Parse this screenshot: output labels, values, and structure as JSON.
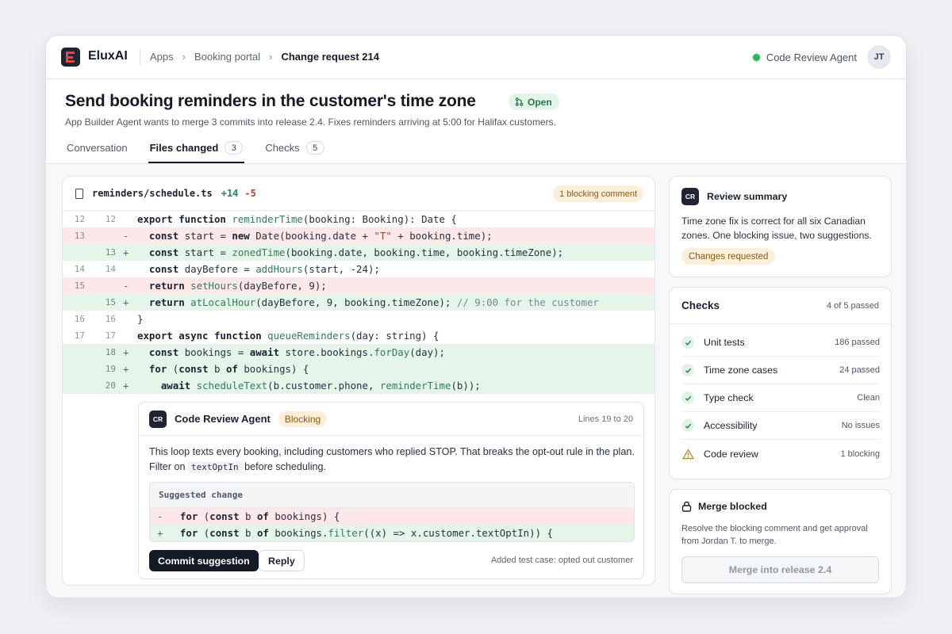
{
  "app": {
    "brand": "EluxAI",
    "breadcrumbs": [
      "Apps",
      "Booking portal",
      "Change request 214"
    ],
    "agent_status": "Code Review Agent",
    "avatar_initials": "JT"
  },
  "pr": {
    "title": "Send booking reminders in the customer's time zone",
    "status": "Open",
    "subtitle": "App Builder Agent wants to merge 3 commits into release 2.4. Fixes reminders arriving at 5:00 for Halifax customers."
  },
  "tabs": [
    {
      "label": "Conversation",
      "count": ""
    },
    {
      "label": "Files changed",
      "count": "3"
    },
    {
      "label": "Checks",
      "count": "5"
    }
  ],
  "diff": {
    "filename": "reminders/schedule.ts",
    "additions": "+14",
    "deletions": "-5",
    "blocking_badge": "1 blocking comment"
  },
  "comment": {
    "badge": "CR",
    "author": "Code Review Agent",
    "tag": "Blocking",
    "lines": "Lines 19 to 20",
    "text_before": "This loop texts every booking, including customers who replied STOP. That breaks the opt-out rule in the plan. Filter on",
    "inline_code": "textOptIn",
    "text_after": "before scheduling.",
    "suggestion_title": "Suggested change",
    "commit_label": "Commit suggestion",
    "reply_label": "Reply",
    "footer": "Added test case: opted out customer"
  },
  "summary": {
    "badge": "CR",
    "title": "Review summary",
    "text": "Time zone fix is correct for all six Canadian zones. One blocking issue, two suggestions.",
    "status": "Changes requested"
  },
  "checks": {
    "title": "Checks",
    "count": "4 of 5 passed",
    "items": [
      {
        "name": "Unit tests",
        "value": "186 passed"
      },
      {
        "name": "Time zone cases",
        "value": "24 passed"
      },
      {
        "name": "Type check",
        "value": "Clean"
      },
      {
        "name": "Accessibility",
        "value": "No issues"
      },
      {
        "name": "Code review",
        "value": "1 blocking"
      }
    ]
  },
  "merge": {
    "title": "Merge blocked",
    "text": "Resolve the blocking comment and get approval from Jordan T. to merge.",
    "button": "Merge into release 2.4"
  },
  "colors": {
    "accent": "#141a26",
    "brand_red": "#e5483a",
    "added_bg": "#e6f5ea",
    "removed_bg": "#fce8e8",
    "warning_bg": "#fbefd9",
    "success": "#2fb45f"
  }
}
